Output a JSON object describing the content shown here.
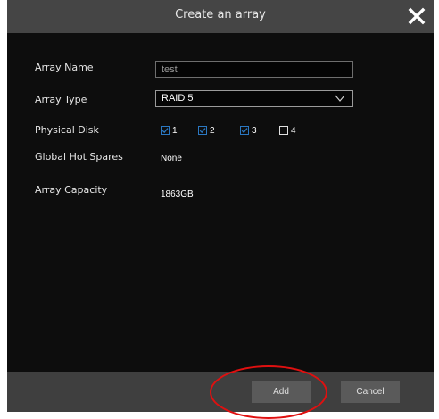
{
  "dialog": {
    "title": "Create an array",
    "close_icon": "close-icon"
  },
  "form": {
    "array_name_label": "Array Name",
    "array_name_value": "test",
    "array_type_label": "Array Type",
    "array_type_value": "RAID 5",
    "physical_disk_label": "Physical Disk",
    "disks": [
      {
        "label": "1",
        "checked": true
      },
      {
        "label": "2",
        "checked": true
      },
      {
        "label": "3",
        "checked": true
      },
      {
        "label": "4",
        "checked": false
      }
    ],
    "hot_spares_label": "Global Hot Spares",
    "hot_spares_value": "None",
    "capacity_label": "Array Capacity",
    "capacity_value": "1863GB"
  },
  "footer": {
    "add_label": "Add",
    "cancel_label": "Cancel"
  },
  "colors": {
    "annotation": "#e01010",
    "checkbox_accent": "#2b78c2"
  }
}
